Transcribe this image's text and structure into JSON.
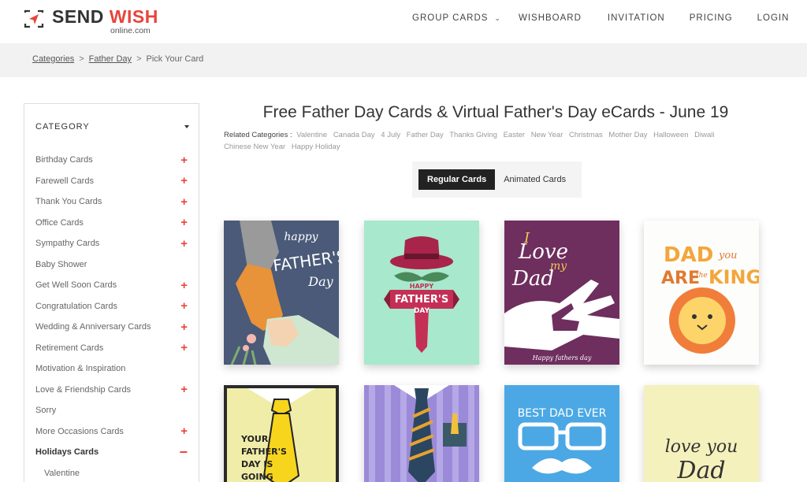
{
  "header": {
    "logo_send": "SEND",
    "logo_wish": "WISH",
    "logo_sub": "online.com",
    "nav": [
      {
        "label": "GROUP CARDS",
        "has_dropdown": true
      },
      {
        "label": "WISHBOARD"
      },
      {
        "label": "INVITATION"
      },
      {
        "label": "PRICING"
      },
      {
        "label": "LOGIN"
      }
    ]
  },
  "breadcrumb": {
    "items": [
      "Categories",
      "Father Day"
    ],
    "current": "Pick Your Card",
    "separator": ">"
  },
  "sidebar": {
    "title": "CATEGORY",
    "items": [
      {
        "label": "Birthday Cards",
        "expand": "+"
      },
      {
        "label": "Farewell Cards",
        "expand": "+"
      },
      {
        "label": "Thank You Cards",
        "expand": "+"
      },
      {
        "label": "Office Cards",
        "expand": "+"
      },
      {
        "label": "Sympathy Cards",
        "expand": "+"
      },
      {
        "label": "Baby Shower",
        "expand": ""
      },
      {
        "label": "Get Well Soon Cards",
        "expand": "+"
      },
      {
        "label": "Congratulation Cards",
        "expand": "+"
      },
      {
        "label": "Wedding & Anniversary Cards",
        "expand": "+"
      },
      {
        "label": "Retirement Cards",
        "expand": "+"
      },
      {
        "label": "Motivation & Inspiration",
        "expand": ""
      },
      {
        "label": "Love & Friendship Cards",
        "expand": "+"
      },
      {
        "label": "Sorry",
        "expand": ""
      },
      {
        "label": "More Occasions Cards",
        "expand": "+"
      },
      {
        "label": "Holidays Cards",
        "expand": "−"
      }
    ],
    "sub_items": [
      "Valentine"
    ]
  },
  "main": {
    "title": "Free Father Day Cards & Virtual Father's Day eCards - June 19",
    "related_label": "Related Categories :",
    "related": [
      "Valentine",
      "Canada Day",
      "4 July",
      "Father Day",
      "Thanks Giving",
      "Easter",
      "New Year",
      "Christmas",
      "Mother Day",
      "Halloween",
      "Diwali",
      "Chinese New Year",
      "Happy Holiday"
    ],
    "tabs": [
      "Regular Cards",
      "Animated Cards"
    ]
  },
  "cards": {
    "c1": {
      "line1": "happy",
      "line2": "FATHER'S",
      "line3": "Day"
    },
    "c2": {
      "line1": "HAPPY",
      "line2": "FATHER'S",
      "line3": "DAY"
    },
    "c3": {
      "line1": "I",
      "line2": "Love",
      "line3": "my",
      "line4": "Dad",
      "footer": "Happy fathers day"
    },
    "c4": {
      "line1": "DAD",
      "line2": "you",
      "line3": "ARE",
      "line4": "the",
      "line5": "KING"
    },
    "c5": {
      "line1": "YOUR",
      "line2": "FATHER'S",
      "line3": "DAY IS",
      "line4": "GOING"
    },
    "c7": {
      "line1": "BEST DAD EVER"
    },
    "c8": {
      "line1": "love you",
      "line2": "Dad"
    }
  },
  "colors": {
    "brand_red": "#e8453c",
    "tab_active_bg": "#222222"
  }
}
